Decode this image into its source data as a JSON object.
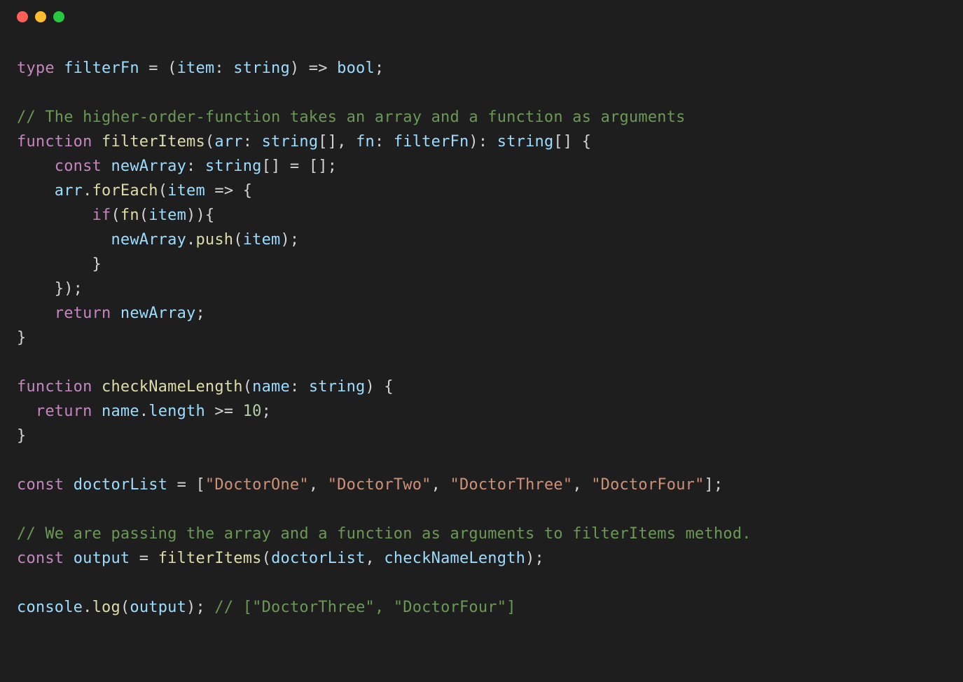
{
  "window": {
    "traffic": [
      "close",
      "minimize",
      "maximize"
    ]
  },
  "code": {
    "lines": [
      [
        {
          "c": "tok-keyword",
          "t": "type"
        },
        {
          "c": "tok-default",
          "t": " "
        },
        {
          "c": "tok-ident",
          "t": "filterFn"
        },
        {
          "c": "tok-default",
          "t": " = ("
        },
        {
          "c": "tok-ident",
          "t": "item"
        },
        {
          "c": "tok-default",
          "t": ": "
        },
        {
          "c": "tok-ident",
          "t": "string"
        },
        {
          "c": "tok-default",
          "t": ") => "
        },
        {
          "c": "tok-ident",
          "t": "bool"
        },
        {
          "c": "tok-default",
          "t": ";"
        }
      ],
      [],
      [
        {
          "c": "tok-comment",
          "t": "// The higher-order-function takes an array and a function as arguments"
        }
      ],
      [
        {
          "c": "tok-keyword",
          "t": "function"
        },
        {
          "c": "tok-default",
          "t": " "
        },
        {
          "c": "tok-func",
          "t": "filterItems"
        },
        {
          "c": "tok-default",
          "t": "("
        },
        {
          "c": "tok-ident",
          "t": "arr"
        },
        {
          "c": "tok-default",
          "t": ": "
        },
        {
          "c": "tok-ident",
          "t": "string"
        },
        {
          "c": "tok-default",
          "t": "[], "
        },
        {
          "c": "tok-ident",
          "t": "fn"
        },
        {
          "c": "tok-default",
          "t": ": "
        },
        {
          "c": "tok-ident",
          "t": "filterFn"
        },
        {
          "c": "tok-default",
          "t": "): "
        },
        {
          "c": "tok-ident",
          "t": "string"
        },
        {
          "c": "tok-default",
          "t": "[] {"
        }
      ],
      [
        {
          "c": "tok-default",
          "t": "    "
        },
        {
          "c": "tok-keyword",
          "t": "const"
        },
        {
          "c": "tok-default",
          "t": " "
        },
        {
          "c": "tok-ident",
          "t": "newArray"
        },
        {
          "c": "tok-default",
          "t": ": "
        },
        {
          "c": "tok-ident",
          "t": "string"
        },
        {
          "c": "tok-default",
          "t": "[] = [];"
        }
      ],
      [
        {
          "c": "tok-default",
          "t": "    "
        },
        {
          "c": "tok-ident",
          "t": "arr"
        },
        {
          "c": "tok-default",
          "t": "."
        },
        {
          "c": "tok-func",
          "t": "forEach"
        },
        {
          "c": "tok-default",
          "t": "("
        },
        {
          "c": "tok-ident",
          "t": "item"
        },
        {
          "c": "tok-default",
          "t": " => {"
        }
      ],
      [
        {
          "c": "tok-default",
          "t": "        "
        },
        {
          "c": "tok-keyword",
          "t": "if"
        },
        {
          "c": "tok-default",
          "t": "("
        },
        {
          "c": "tok-func",
          "t": "fn"
        },
        {
          "c": "tok-default",
          "t": "("
        },
        {
          "c": "tok-ident",
          "t": "item"
        },
        {
          "c": "tok-default",
          "t": ")){"
        }
      ],
      [
        {
          "c": "tok-default",
          "t": "          "
        },
        {
          "c": "tok-ident",
          "t": "newArray"
        },
        {
          "c": "tok-default",
          "t": "."
        },
        {
          "c": "tok-func",
          "t": "push"
        },
        {
          "c": "tok-default",
          "t": "("
        },
        {
          "c": "tok-ident",
          "t": "item"
        },
        {
          "c": "tok-default",
          "t": ");"
        }
      ],
      [
        {
          "c": "tok-default",
          "t": "        }"
        }
      ],
      [
        {
          "c": "tok-default",
          "t": "    });"
        }
      ],
      [
        {
          "c": "tok-default",
          "t": "    "
        },
        {
          "c": "tok-keyword",
          "t": "return"
        },
        {
          "c": "tok-default",
          "t": " "
        },
        {
          "c": "tok-ident",
          "t": "newArray"
        },
        {
          "c": "tok-default",
          "t": ";"
        }
      ],
      [
        {
          "c": "tok-default",
          "t": "}"
        }
      ],
      [],
      [
        {
          "c": "tok-keyword",
          "t": "function"
        },
        {
          "c": "tok-default",
          "t": " "
        },
        {
          "c": "tok-func",
          "t": "checkNameLength"
        },
        {
          "c": "tok-default",
          "t": "("
        },
        {
          "c": "tok-ident",
          "t": "name"
        },
        {
          "c": "tok-default",
          "t": ": "
        },
        {
          "c": "tok-ident",
          "t": "string"
        },
        {
          "c": "tok-default",
          "t": ") {"
        }
      ],
      [
        {
          "c": "tok-default",
          "t": "  "
        },
        {
          "c": "tok-keyword",
          "t": "return"
        },
        {
          "c": "tok-default",
          "t": " "
        },
        {
          "c": "tok-ident",
          "t": "name"
        },
        {
          "c": "tok-default",
          "t": "."
        },
        {
          "c": "tok-ident",
          "t": "length"
        },
        {
          "c": "tok-default",
          "t": " >= "
        },
        {
          "c": "tok-number",
          "t": "10"
        },
        {
          "c": "tok-default",
          "t": ";"
        }
      ],
      [
        {
          "c": "tok-default",
          "t": "}"
        }
      ],
      [],
      [
        {
          "c": "tok-keyword",
          "t": "const"
        },
        {
          "c": "tok-default",
          "t": " "
        },
        {
          "c": "tok-ident",
          "t": "doctorList"
        },
        {
          "c": "tok-default",
          "t": " = ["
        },
        {
          "c": "tok-string",
          "t": "\"DoctorOne\""
        },
        {
          "c": "tok-default",
          "t": ", "
        },
        {
          "c": "tok-string",
          "t": "\"DoctorTwo\""
        },
        {
          "c": "tok-default",
          "t": ", "
        },
        {
          "c": "tok-string",
          "t": "\"DoctorThree\""
        },
        {
          "c": "tok-default",
          "t": ", "
        },
        {
          "c": "tok-string",
          "t": "\"DoctorFour\""
        },
        {
          "c": "tok-default",
          "t": "];"
        }
      ],
      [],
      [
        {
          "c": "tok-comment",
          "t": "// We are passing the array and a function as arguments to filterItems method."
        }
      ],
      [
        {
          "c": "tok-keyword",
          "t": "const"
        },
        {
          "c": "tok-default",
          "t": " "
        },
        {
          "c": "tok-ident",
          "t": "output"
        },
        {
          "c": "tok-default",
          "t": " = "
        },
        {
          "c": "tok-func",
          "t": "filterItems"
        },
        {
          "c": "tok-default",
          "t": "("
        },
        {
          "c": "tok-ident",
          "t": "doctorList"
        },
        {
          "c": "tok-default",
          "t": ", "
        },
        {
          "c": "tok-ident",
          "t": "checkNameLength"
        },
        {
          "c": "tok-default",
          "t": ");"
        }
      ],
      [],
      [
        {
          "c": "tok-ident",
          "t": "console"
        },
        {
          "c": "tok-default",
          "t": "."
        },
        {
          "c": "tok-func",
          "t": "log"
        },
        {
          "c": "tok-default",
          "t": "("
        },
        {
          "c": "tok-ident",
          "t": "output"
        },
        {
          "c": "tok-default",
          "t": "); "
        },
        {
          "c": "tok-comment",
          "t": "// [\"DoctorThree\", \"DoctorFour\"]"
        }
      ]
    ]
  }
}
